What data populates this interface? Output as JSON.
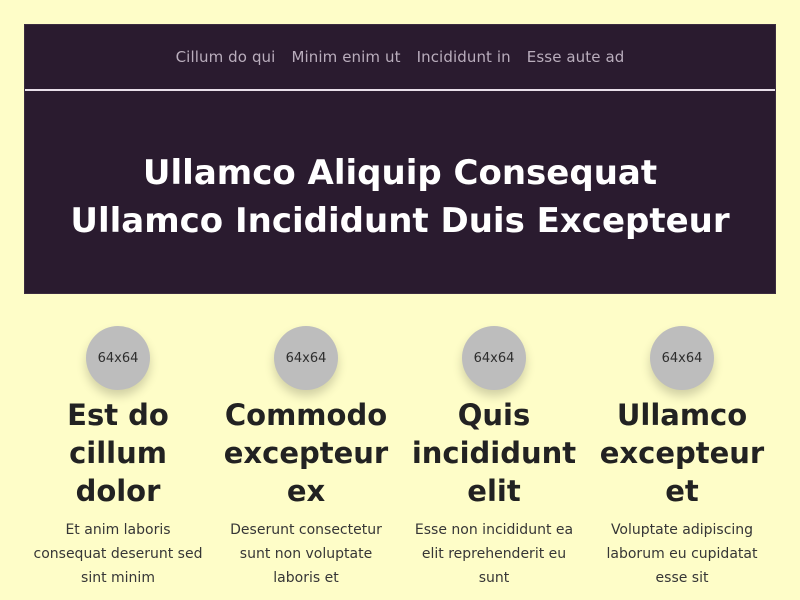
{
  "nav": {
    "items": [
      {
        "label": "Cillum do qui"
      },
      {
        "label": "Minim enim ut"
      },
      {
        "label": "Incididunt in"
      },
      {
        "label": "Esse aute ad"
      }
    ]
  },
  "hero": {
    "title": "Ullamco Aliquip Consequat Ullamco Incididunt Duis Excepteur"
  },
  "features": [
    {
      "image_text": "64x64",
      "heading": "Est do cillum dolor",
      "description": "Et anim laboris consequat deserunt sed sint minim"
    },
    {
      "image_text": "64x64",
      "heading": "Commodo excepteur ex",
      "description": "Deserunt consectetur sunt non voluptate laboris et"
    },
    {
      "image_text": "64x64",
      "heading": "Quis incididunt elit",
      "description": "Esse non incididunt ea elit reprehenderit eu sunt"
    },
    {
      "image_text": "64x64",
      "heading": "Ullamco excepteur et",
      "description": "Voluptate adipiscing laborum eu cupidatat esse sit"
    }
  ],
  "colors": {
    "page_background": "#fefdc8",
    "hero_background": "#2a1b2f",
    "nav_text": "#b9adbc",
    "title_text": "#ffffff",
    "avatar_background": "#bdbdbd"
  }
}
